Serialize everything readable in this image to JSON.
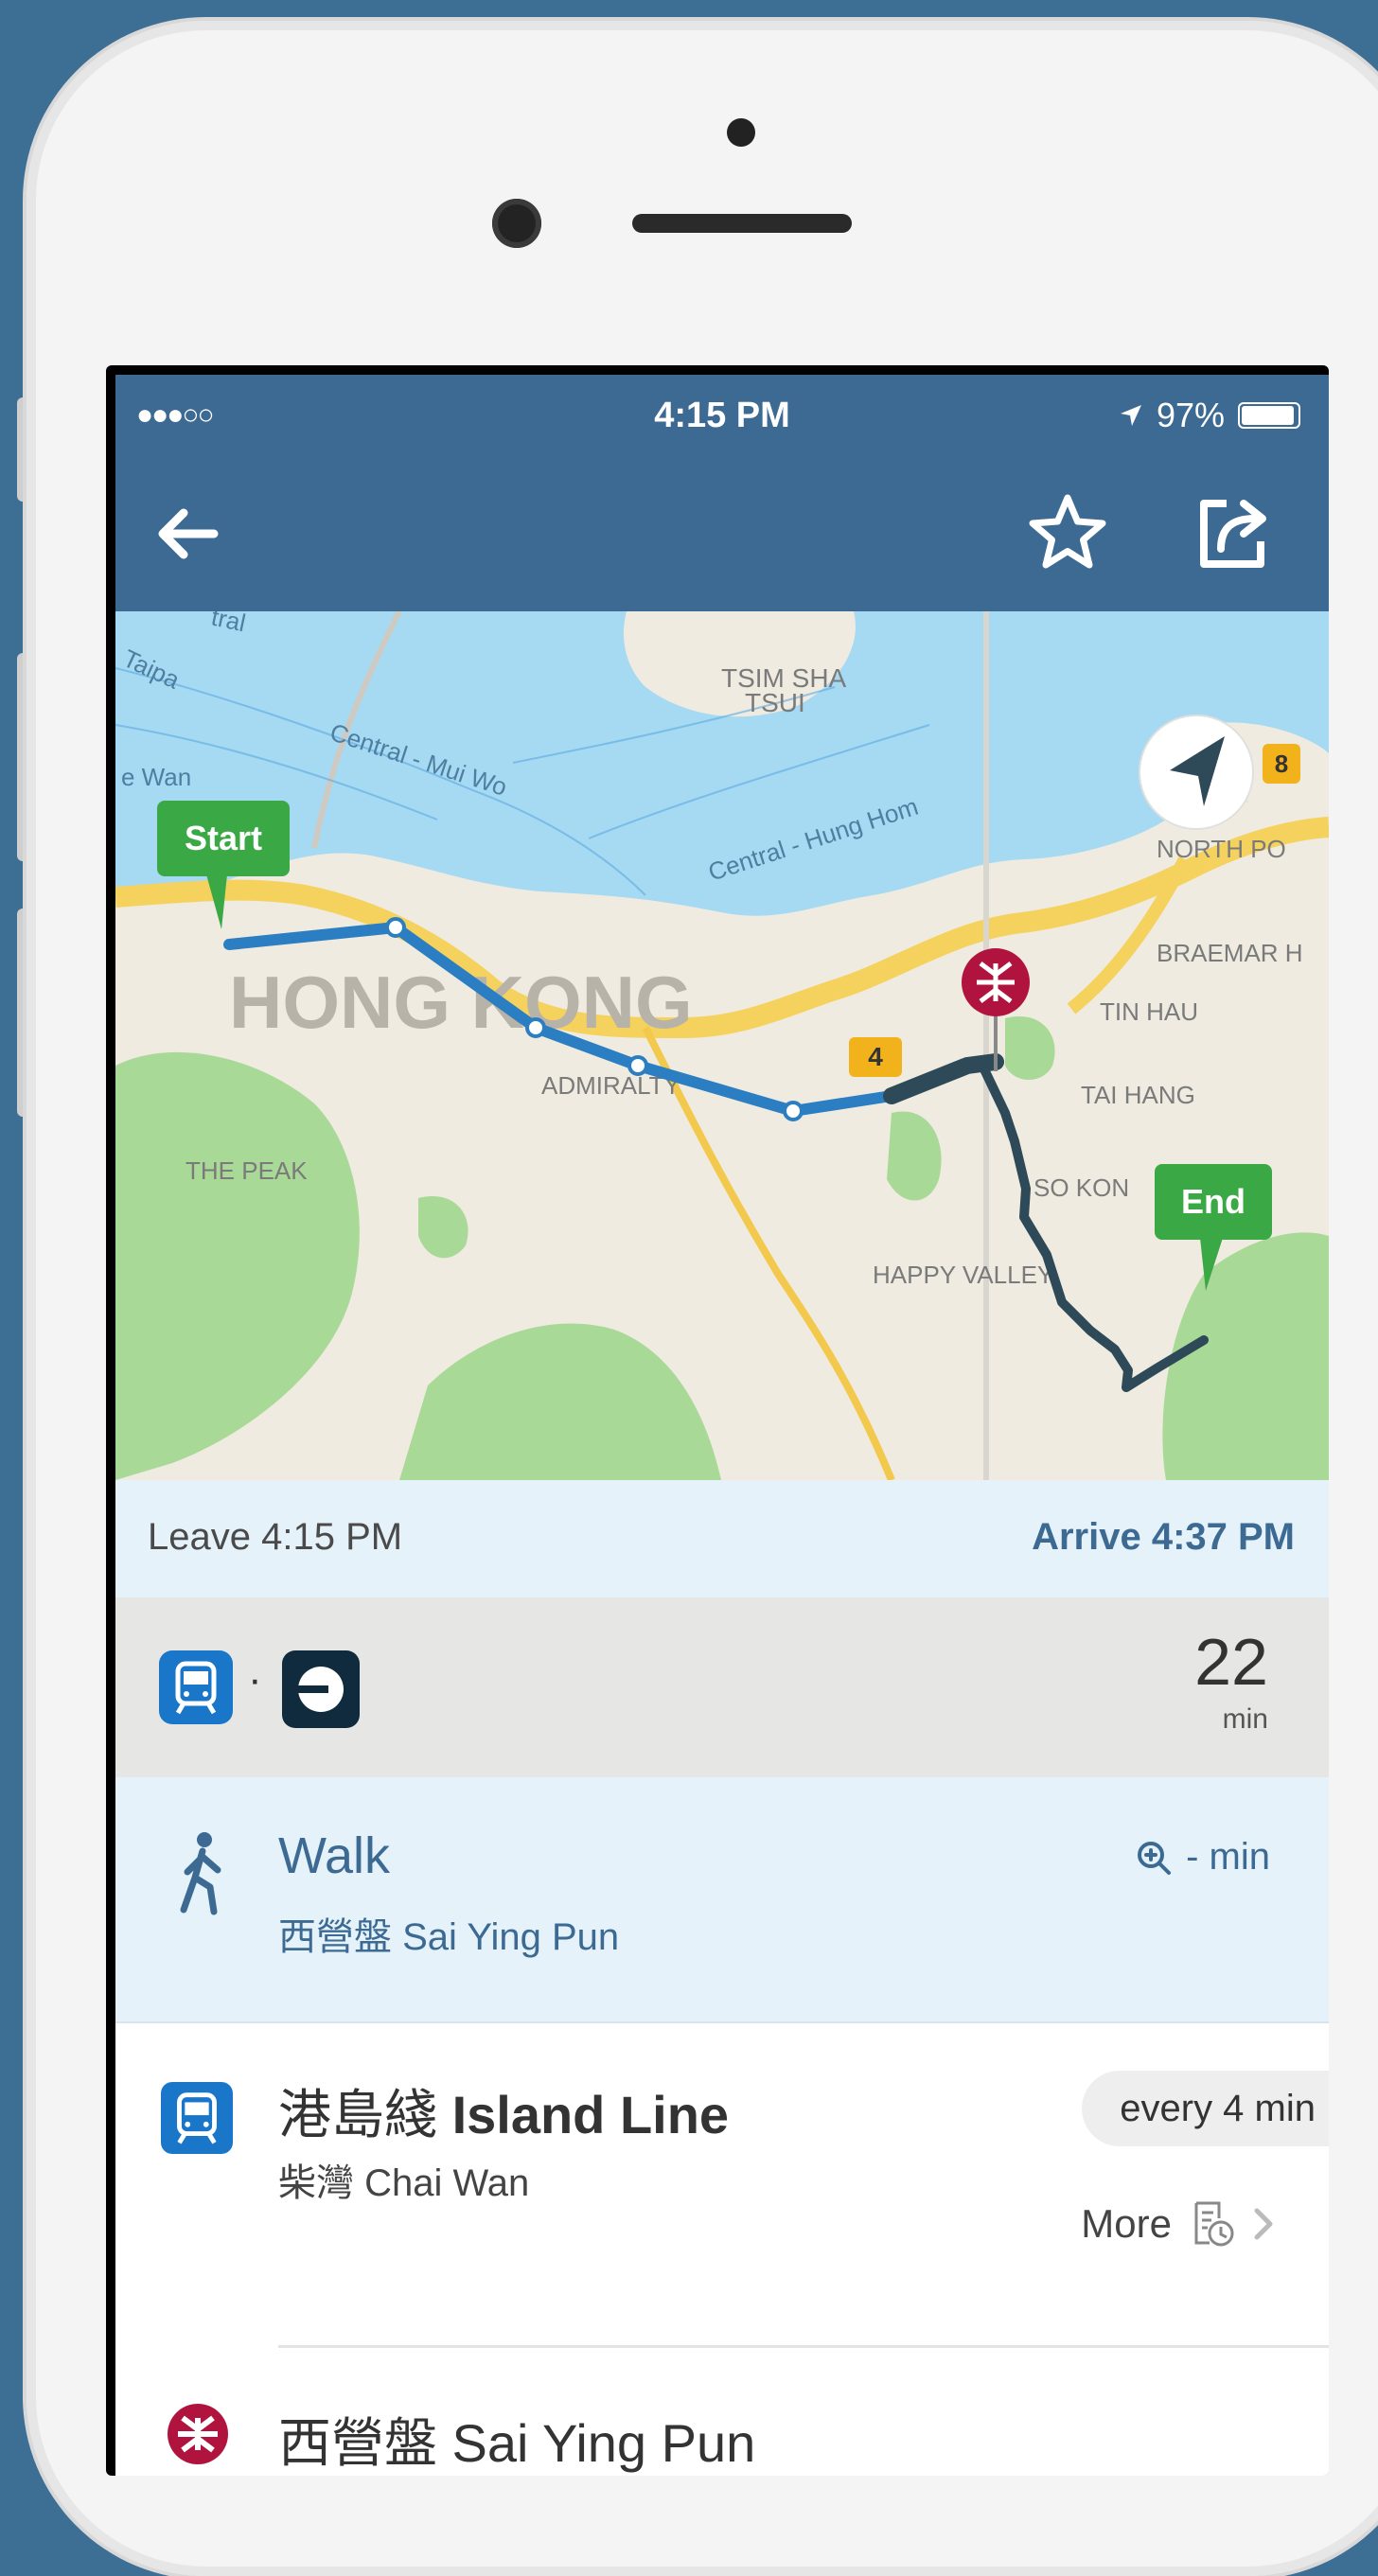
{
  "status_bar": {
    "signal": "●●●○○",
    "time": "4:15 PM",
    "location_icon": "location-arrow-icon",
    "battery": "97%",
    "battery_level": 0.97
  },
  "nav": {
    "back_icon": "back-arrow-icon",
    "favorite_icon": "star-icon",
    "share_icon": "share-icon"
  },
  "map": {
    "labels": {
      "tsim_sha_tsui_1": "TSIM SHA",
      "tsim_sha_tsui_2": "TSUI",
      "taipa": "Taipa",
      "tral": "tral",
      "wan": "e Wan",
      "central_mui_wo": "Central - Mui Wo",
      "central_hung_hom": "Central - Hung Hom",
      "north_point": "NORTH PO",
      "braemar": "BRAEMAR H",
      "tin_hau": "TIN HAU",
      "tai_hang": "TAI HANG",
      "hong_kong": "HONG KONG",
      "admiralty": "ADMIRALTY",
      "the_peak": "THE PEAK",
      "so_kon": "SO KON",
      "happy_valley": "HAPPY VALLEY",
      "route_4": "4",
      "route_8": "8"
    },
    "start_label": "Start",
    "end_label": "End",
    "locate_icon": "navigation-arrow-icon",
    "colors": {
      "water": "#a6d9f2",
      "land": "#efebe0",
      "park": "#a9d996",
      "road": "#f5d25d",
      "transit_route": "#2b7ec1",
      "drive_route": "#2e4957",
      "pin": "#3aa845",
      "mtr": "#b0133d"
    }
  },
  "trip": {
    "leave": "Leave 4:15 PM",
    "arrive": "Arrive 4:37 PM",
    "duration": "22",
    "duration_unit": "min",
    "modes": [
      "metro-icon",
      "uber-icon"
    ],
    "mode_separator": "·"
  },
  "steps": {
    "walk": {
      "title": "Walk",
      "subtitle": "西營盤 Sai Ying Pun",
      "time": "- min",
      "icon": "walking-person-icon"
    },
    "line": {
      "title_cn": "港島綫",
      "title_en": "Island Line",
      "subtitle": "柴灣 Chai Wan",
      "frequency": "every 4 min",
      "more": "More",
      "icon": "metro-icon"
    },
    "station": {
      "name": "西營盤 Sai Ying Pun",
      "icon": "mtr-logo-icon"
    }
  },
  "colors": {
    "header": "#3c6a92",
    "accent_blue": "#1976c8",
    "light_blue_bg": "#e5f2fa",
    "background": "#3d6e94"
  }
}
